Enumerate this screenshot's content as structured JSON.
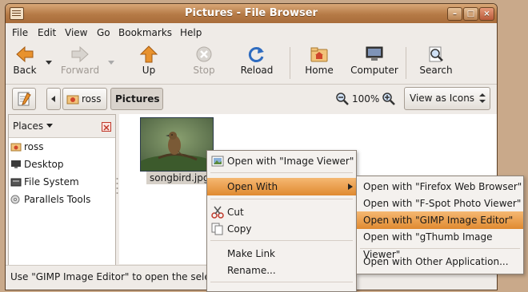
{
  "window": {
    "title": "Pictures - File Browser"
  },
  "menubar": {
    "file": "File",
    "edit": "Edit",
    "view": "View",
    "go": "Go",
    "bookmarks": "Bookmarks",
    "help": "Help"
  },
  "toolbar": {
    "back": "Back",
    "forward": "Forward",
    "up": "Up",
    "stop": "Stop",
    "reload": "Reload",
    "home": "Home",
    "computer": "Computer",
    "search": "Search"
  },
  "location": {
    "crumb_home": "ross",
    "crumb_current": "Pictures",
    "zoom": "100%",
    "view_mode": "View as Icons"
  },
  "sidebar": {
    "header": "Places",
    "items": [
      "ross",
      "Desktop",
      "File System",
      "Parallels Tools"
    ]
  },
  "file": {
    "name": "songbird.jpg"
  },
  "status": {
    "text": "Use \"GIMP Image Editor\" to open the selected item"
  },
  "context_menu": {
    "open_image_viewer": "Open with \"Image Viewer\"",
    "open_with": "Open With",
    "cut": "Cut",
    "copy": "Copy",
    "make_link": "Make Link",
    "rename": "Rename..."
  },
  "submenu": {
    "items": [
      "Open with \"Firefox Web Browser\"",
      "Open with \"F-Spot Photo Viewer\"",
      "Open with \"GIMP Image Editor\"",
      "Open with \"gThumb Image Viewer\"",
      "Open with Other Application..."
    ],
    "highlighted_index": 2
  },
  "colors": {
    "titlebar": "#b57a46",
    "highlight": "#e08a30",
    "window_bg": "#efebe7"
  }
}
